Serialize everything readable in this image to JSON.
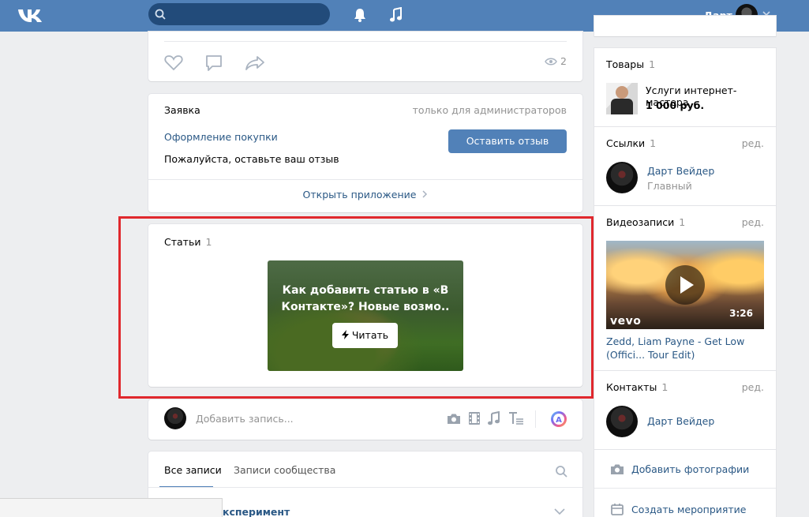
{
  "header": {
    "user_name": "Дарт"
  },
  "post": {
    "views": "2"
  },
  "app": {
    "title": "Заявка",
    "visibility": "только для администраторов",
    "link": "Оформление покупки",
    "subtitle": "Пожалуйста, оставьте ваш отзыв",
    "button": "Оставить отзыв",
    "open": "Открыть приложение"
  },
  "articles": {
    "title": "Статьи",
    "count": "1",
    "article_title": "Как добавить статью в «В Контакте»? Новые возмо..",
    "read": "Читать"
  },
  "composer": {
    "placeholder": "Добавить запись..."
  },
  "feed": {
    "tab_all": "Все записи",
    "tab_community": "Записи сообщества",
    "partial_post": "ксперимент"
  },
  "goods": {
    "title": "Товары",
    "count": "1",
    "item": "Услуги интернет-мастера",
    "price": "1 000 руб."
  },
  "links": {
    "title": "Ссылки",
    "count": "1",
    "edit": "ред.",
    "name": "Дарт Вейдер",
    "desc": "Главный"
  },
  "videos": {
    "title": "Видеозаписи",
    "count": "1",
    "edit": "ред.",
    "brand": "vevo",
    "duration": "3:26",
    "video_title": "Zedd, Liam Payne - Get Low (Offici... Tour Edit)"
  },
  "contacts": {
    "title": "Контакты",
    "count": "1",
    "edit": "ред.",
    "name": "Дарт Вейдер"
  },
  "actions": {
    "add_photos": "Добавить фотографии",
    "create_event": "Создать мероприятие"
  },
  "colors": {
    "header": "#5181b8",
    "accent": "#5181b8",
    "highlight": "#e0282d",
    "link": "#2a5885"
  }
}
